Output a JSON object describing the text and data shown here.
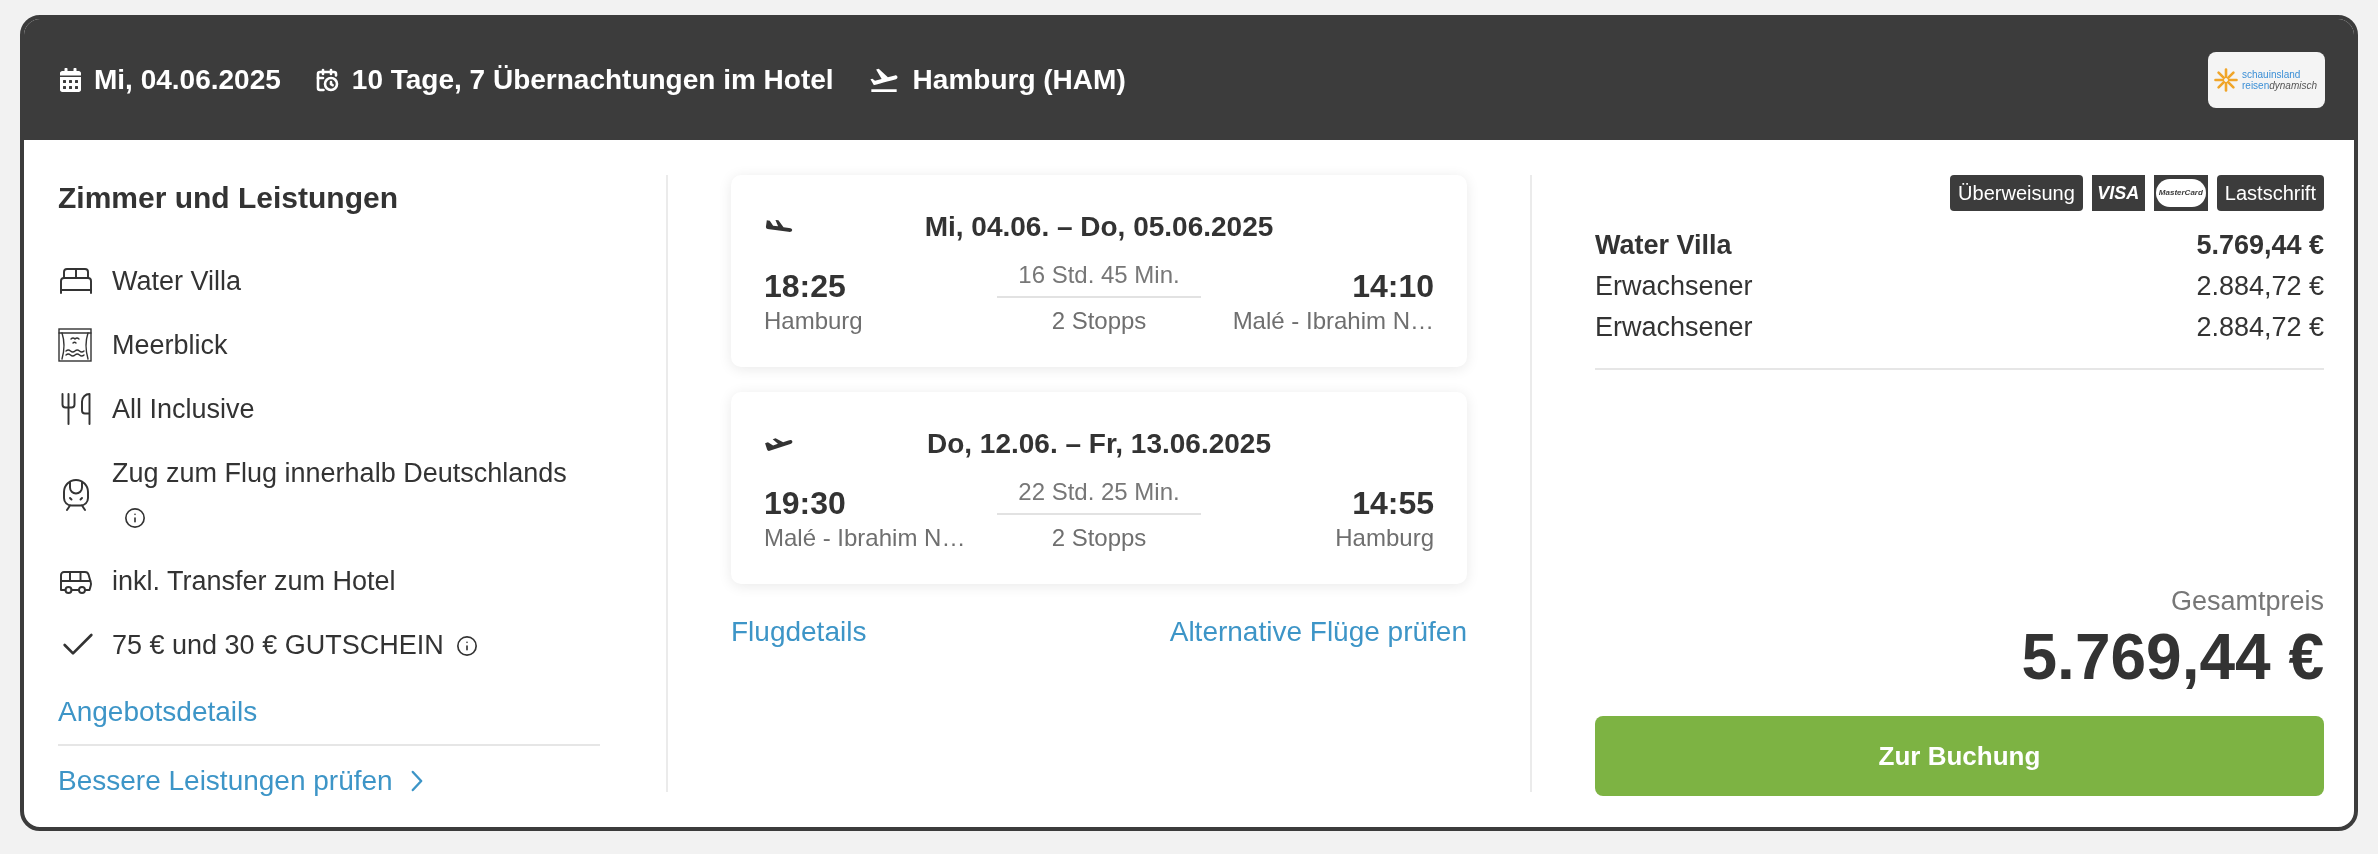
{
  "header": {
    "items": [
      {
        "kind": "date",
        "text": "Mi, 04.06.2025"
      },
      {
        "kind": "duration",
        "text": "10 Tage, 7 Übernachtungen im Hotel"
      },
      {
        "kind": "departure",
        "text": "Hamburg (HAM)"
      }
    ],
    "logo": {
      "line_1": "schauinsland",
      "line_2": "reisen",
      "line_2_suffix": "dynamisch"
    }
  },
  "services": {
    "title": "Zimmer und Leistungen",
    "items": [
      {
        "kind": "room",
        "text": "Water Villa",
        "info": false
      },
      {
        "kind": "view",
        "text": "Meerblick",
        "info": false
      },
      {
        "kind": "board",
        "text": "All Inclusive",
        "info": false
      },
      {
        "kind": "train",
        "text": "Zug zum Flug innerhalb Deutschlands",
        "info": true
      },
      {
        "kind": "transfer",
        "text": "inkl. Transfer zum Hotel",
        "info": false
      },
      {
        "kind": "voucher",
        "text": "75 € und 30 € GUTSCHEIN",
        "info": true
      }
    ],
    "details_link": "Angebotsdetails",
    "upgrade_link": "Bessere Leistungen prüfen"
  },
  "flights": {
    "legs": [
      {
        "kind": "outbound",
        "dates": "Mi, 04.06. – Do, 05.06.2025",
        "departure_time": "18:25",
        "departure_place": "Hamburg",
        "duration": "16 Std. 45 Min.",
        "stops": "2 Stopps",
        "arrival_time": "14:10",
        "arrival_place": "Malé - Ibrahim N…"
      },
      {
        "kind": "return",
        "dates": "Do, 12.06. – Fr, 13.06.2025",
        "departure_time": "19:30",
        "departure_place": "Malé - Ibrahim N…",
        "duration": "22 Std. 25 Min.",
        "stops": "2 Stopps",
        "arrival_time": "14:55",
        "arrival_place": "Hamburg"
      }
    ],
    "details_link": "Flugdetails",
    "alternatives_link": "Alternative Flüge prüfen"
  },
  "price": {
    "payment_methods": [
      {
        "kind": "label",
        "text": "Überweisung"
      },
      {
        "kind": "visa",
        "text": "VISA"
      },
      {
        "kind": "mastercard",
        "text": "MasterCard"
      },
      {
        "kind": "label",
        "text": "Lastschrift"
      }
    ],
    "lines": [
      {
        "label": "Water Villa",
        "amount": "5.769,44 €",
        "emphasis": true
      },
      {
        "label": "Erwachsener",
        "amount": "2.884,72 €",
        "emphasis": false
      },
      {
        "label": "Erwachsener",
        "amount": "2.884,72 €",
        "emphasis": false
      }
    ],
    "total_label": "Gesamtpreis",
    "total": "5.769,44 €",
    "book_button": "Zur Buchung"
  }
}
